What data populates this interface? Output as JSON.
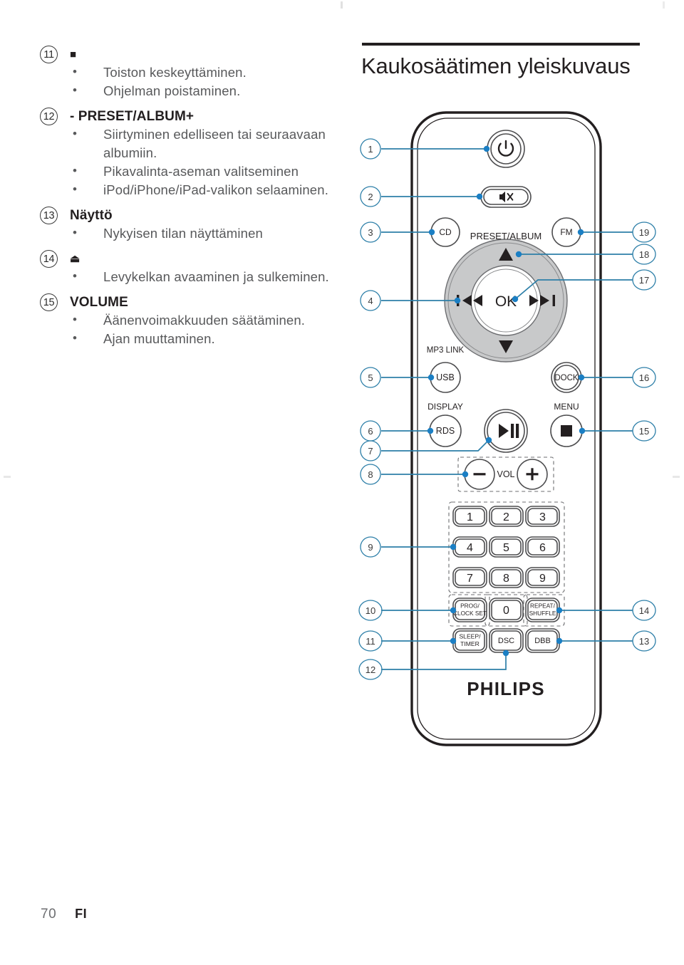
{
  "page": {
    "number": "70",
    "language": "FI"
  },
  "left_column": {
    "entries": [
      {
        "badge": "11",
        "heading": "■",
        "heading_is_symbol": true,
        "bullets": [
          "Toiston keskeyttäminen.",
          "Ohjelman poistaminen."
        ]
      },
      {
        "badge": "12",
        "heading": "- PRESET/ALBUM+",
        "heading_is_symbol": false,
        "bullets": [
          "Siirtyminen edelliseen tai seuraavaan albumiin.",
          "Pikavalinta-aseman valitseminen",
          "iPod/iPhone/iPad-valikon selaaminen."
        ]
      },
      {
        "badge": "13",
        "heading": "Näyttö",
        "heading_is_symbol": false,
        "bullets": [
          "Nykyisen tilan näyttäminen"
        ]
      },
      {
        "badge": "14",
        "heading": "⏏",
        "heading_is_symbol": true,
        "bullets": [
          "Levykelkan avaaminen ja sulkeminen."
        ]
      },
      {
        "badge": "15",
        "heading": "VOLUME",
        "heading_is_symbol": false,
        "bullets": [
          "Äänenvoimakkuuden säätäminen.",
          "Ajan muuttaminen."
        ]
      }
    ]
  },
  "right_column": {
    "section_title": "Kaukosäätimen yleiskuvaus"
  },
  "remote": {
    "brand": "PHILIPS",
    "buttons": {
      "power": "power-icon",
      "mute": "mute-icon",
      "cd": "CD",
      "fm": "FM",
      "preset_album_label": "PRESET/ALBUM",
      "up": "▲",
      "down": "▼",
      "prev": "⏮",
      "next": "⏭",
      "ok": "OK",
      "mp3_link_label": "MP3 LINK",
      "usb": "USB",
      "dock": "DOCK",
      "display_label": "DISPLAY",
      "rds": "RDS",
      "play_pause": "▶❘❘",
      "menu_label": "MENU",
      "stop": "■",
      "vol_minus": "−",
      "vol_label": "VOL",
      "vol_plus": "+",
      "keypad": [
        "1",
        "2",
        "3",
        "4",
        "5",
        "6",
        "7",
        "8",
        "9"
      ],
      "zero": "0",
      "prog_clock_set": [
        "PROG/",
        "CLOCK SET"
      ],
      "repeat_shuffle": [
        "REPEAT/",
        "SHUFFLE"
      ],
      "sleep_timer": [
        "SLEEP/",
        "TIMER"
      ],
      "dsc": "DSC",
      "dbb": "DBB"
    },
    "callouts_left": [
      "1",
      "2",
      "3",
      "4",
      "5",
      "6",
      "7",
      "8",
      "9",
      "10",
      "11",
      "12"
    ],
    "callouts_right": [
      "19",
      "18",
      "17",
      "16",
      "15",
      "14",
      "13"
    ]
  },
  "colors": {
    "callout_line": "#2d7fa8",
    "callout_dot": "#1b7fc4",
    "ink": "#231f20",
    "body_text": "#58595b",
    "wheel_fill": "#c8c9ca"
  }
}
